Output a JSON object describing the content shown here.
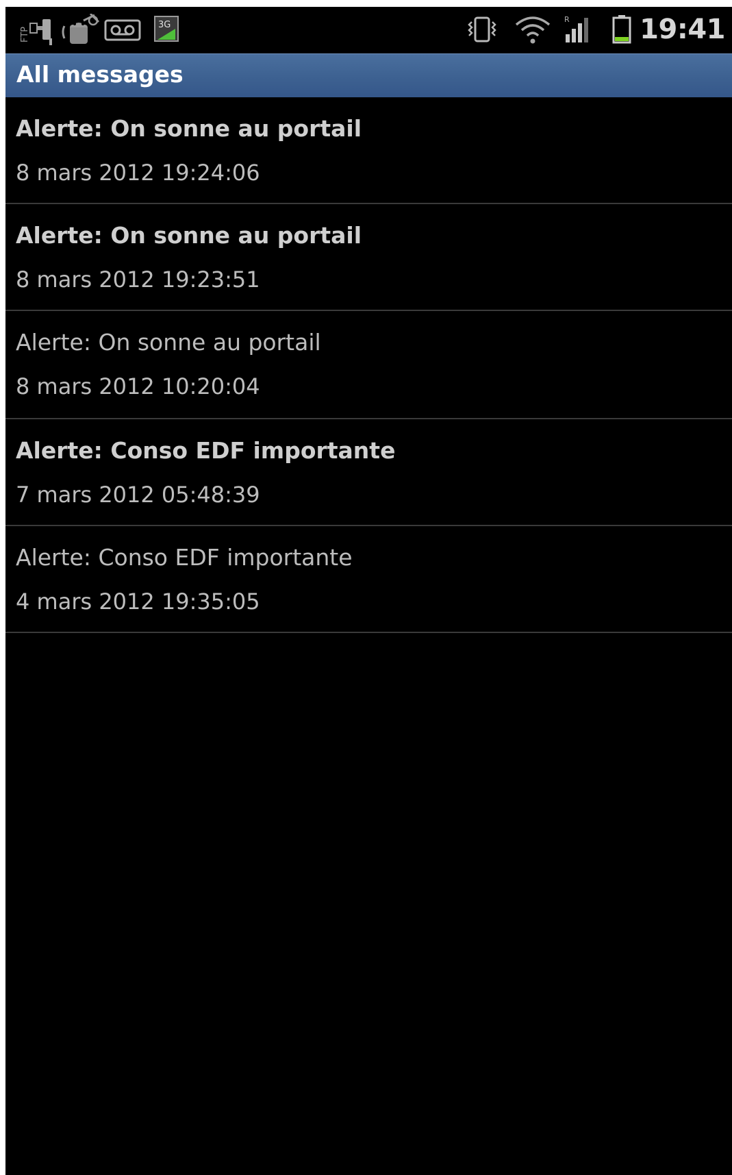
{
  "status_bar": {
    "time": "19:41",
    "network_badge": "3G",
    "ftp_label": "FTP",
    "icons_left": [
      "ftp-usb-icon",
      "usb-debug-icon",
      "voicemail-icon",
      "3g-data-icon"
    ],
    "icons_right": [
      "vibrate-icon",
      "wifi-icon",
      "signal-icon",
      "battery-icon"
    ]
  },
  "header": {
    "title": "All messages",
    "background_color": "#3d6191"
  },
  "messages": [
    {
      "title": "Alerte: On sonne au portail",
      "date": "8 mars 2012 19:24:06",
      "unread": true
    },
    {
      "title": "Alerte: On sonne au portail",
      "date": "8 mars 2012 19:23:51",
      "unread": true
    },
    {
      "title": "Alerte: On sonne au portail",
      "date": "8 mars 2012 10:20:04",
      "unread": false
    },
    {
      "title": "Alerte: Conso EDF importante",
      "date": "7 mars 2012 05:48:39",
      "unread": true
    },
    {
      "title": "Alerte: Conso EDF importante",
      "date": "4 mars 2012 19:35:05",
      "unread": false
    }
  ]
}
